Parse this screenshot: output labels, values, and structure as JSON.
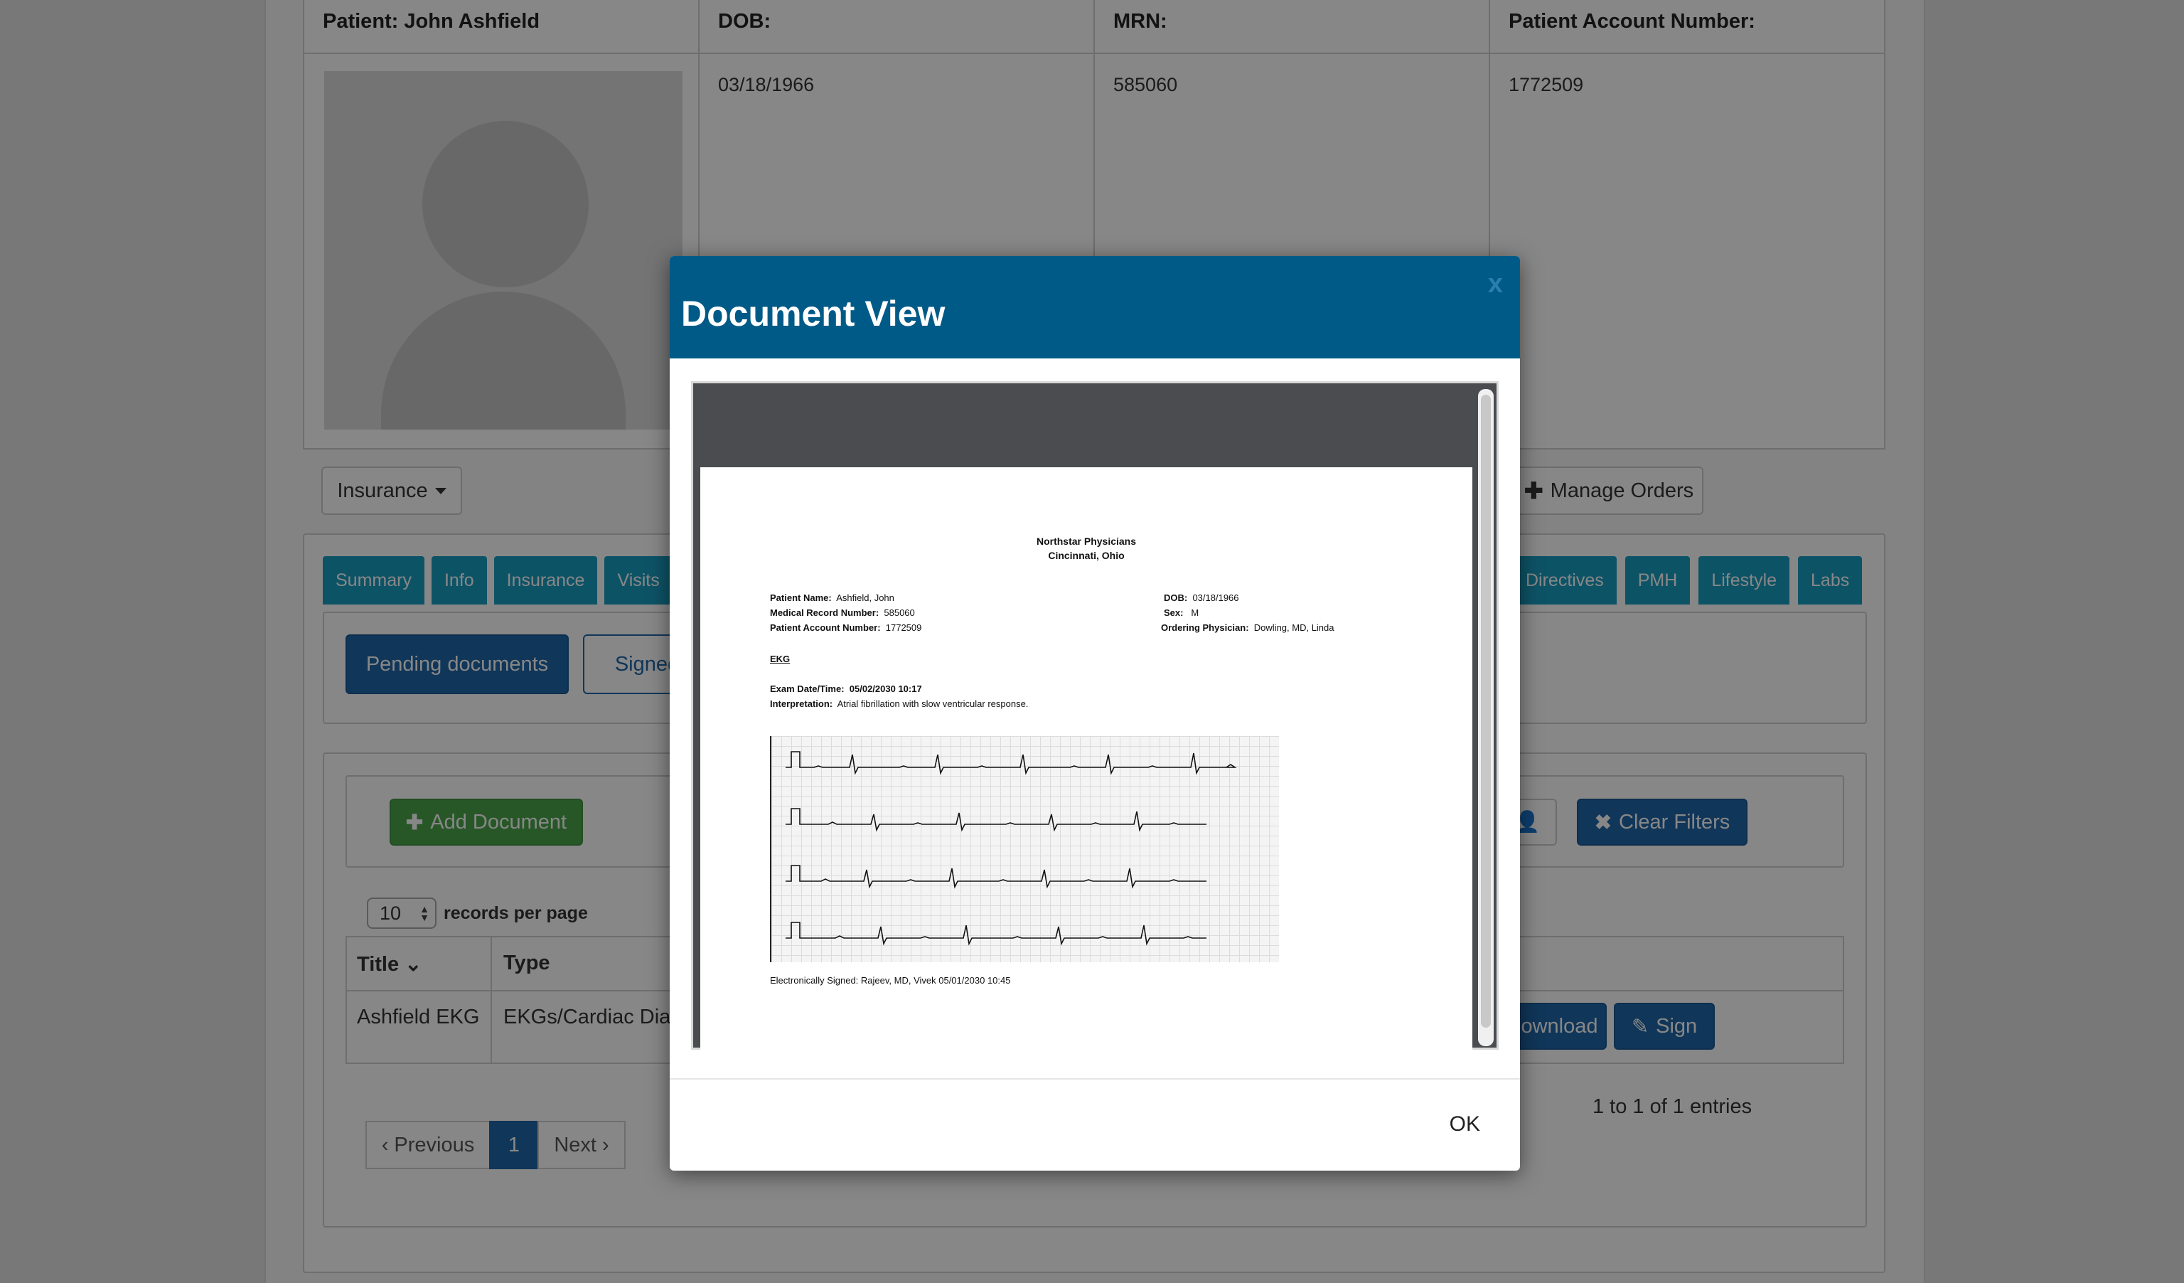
{
  "patient": {
    "name_label": "Patient: John Ashfield",
    "dob_label": "DOB:",
    "dob": "03/18/1966",
    "mrn_label": "MRN:",
    "mrn": "585060",
    "account_label": "Patient Account Number:",
    "account": "1772509"
  },
  "toolbar": {
    "insurance_label": "Insurance",
    "manage_orders_label": "Manage Orders"
  },
  "tabs": {
    "left": [
      "Summary",
      "Info",
      "Insurance",
      "Visits"
    ],
    "right": [
      "Directives",
      "PMH",
      "Lifestyle",
      "Labs"
    ]
  },
  "subtabs": {
    "pending": "Pending documents",
    "signed": "Signed"
  },
  "actions": {
    "add_document": "Add Document",
    "clear_filters": "Clear Filters"
  },
  "records": {
    "per_page_value": "10",
    "per_page_label": "records per page"
  },
  "table": {
    "headers": [
      "Title",
      "Type"
    ],
    "rows": [
      {
        "title": "Ashfield EKG",
        "type": "EKGs/Cardiac Diag",
        "download": "Download",
        "sign": "Sign"
      }
    ]
  },
  "pagination": {
    "previous": "‹ Previous",
    "page": "1",
    "next": "Next ›",
    "entries": "1 to 1 of 1 entries"
  },
  "modal": {
    "title": "Document View",
    "close": "x",
    "ok": "OK",
    "document": {
      "org": "Northstar Physicians",
      "location": "Cincinnati, Ohio",
      "patient_name_label": "Patient Name:",
      "patient_name": "Ashfield, John",
      "mrn_label": "Medical Record Number:",
      "mrn": "585060",
      "account_label": "Patient Account Number:",
      "account": "1772509",
      "dob_label": "DOB:",
      "dob": "03/18/1966",
      "sex_label": "Sex:",
      "sex": "M",
      "physician_label": "Ordering Physician:",
      "physician": "Dowling, MD, Linda",
      "test": "EKG",
      "exam_label": "Exam Date/Time:",
      "exam": "05/02/2030  10:17",
      "interp_label": "Interpretation:",
      "interp": "Atrial fibrillation with slow ventricular response.",
      "signed": "Electronically Signed:  Rajeev, MD, Vivek  05/01/2030  10:45"
    }
  },
  "colors": {
    "modal_header": "#005a87",
    "tab": "#1a9ec0",
    "primary": "#1f66a8",
    "success": "#4aa54a"
  }
}
